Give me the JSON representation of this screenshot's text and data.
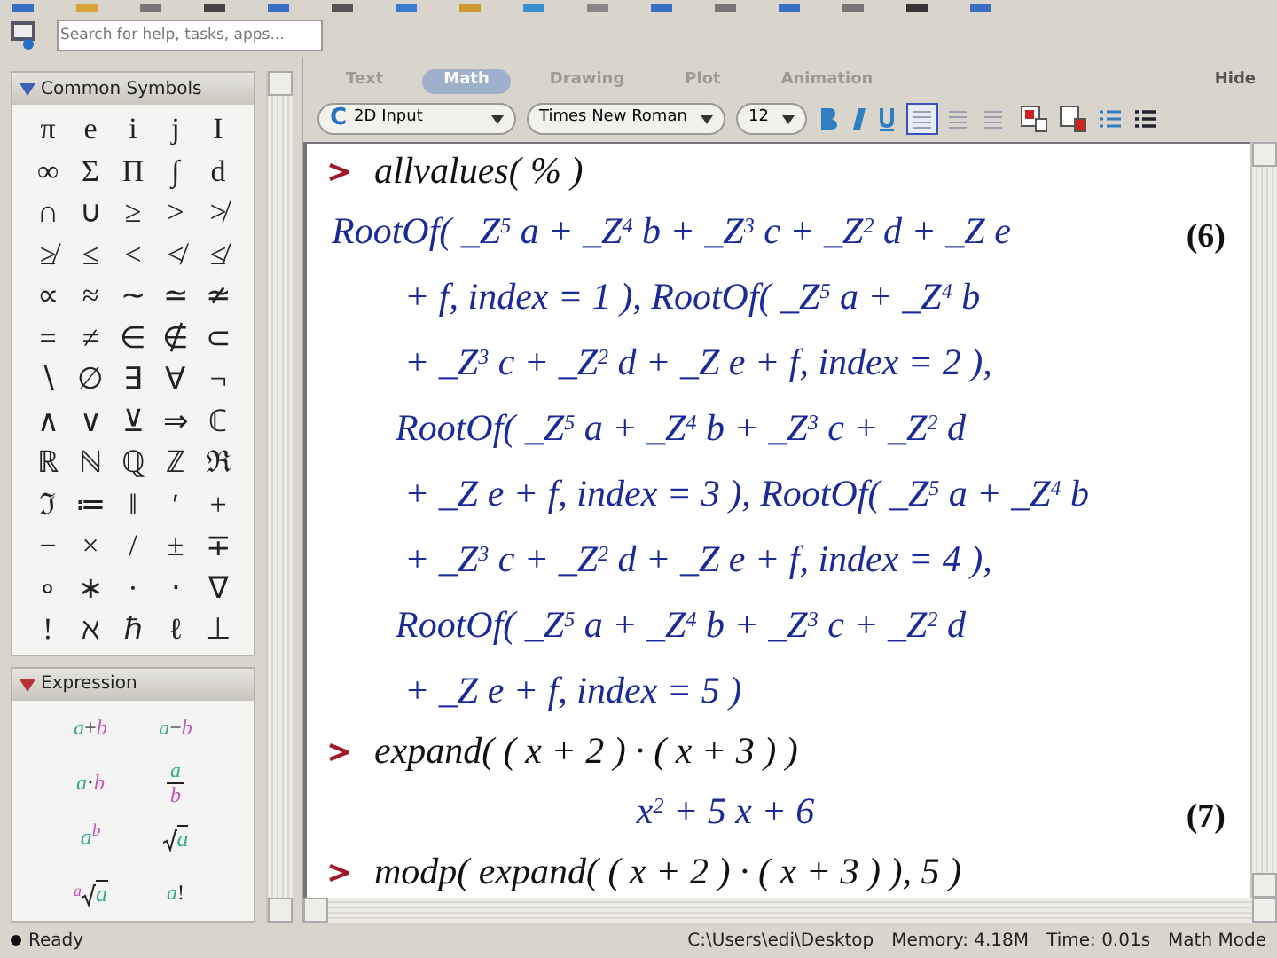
{
  "search": {
    "placeholder": "Search for help, tasks, apps..."
  },
  "palettes": [
    {
      "kind": "symbols",
      "title": "Common Symbols",
      "expanded": true,
      "symbols": [
        "π",
        "e",
        "i",
        "j",
        "I",
        "∞",
        "Σ",
        "Π",
        "∫",
        "d",
        "∩",
        "∪",
        "≥",
        ">",
        "≯",
        "≱",
        "≤",
        "<",
        "≮",
        "≰",
        "∝",
        "≈",
        "∼",
        "≃",
        "≄",
        "=",
        "≠",
        "∈",
        "∉",
        "⊂",
        "∖",
        "∅",
        "∃",
        "∀",
        "¬",
        "∧",
        "∨",
        "⊻",
        "⇒",
        "ℂ",
        "ℝ",
        "ℕ",
        "ℚ",
        "ℤ",
        "ℜ",
        "ℑ",
        "≔",
        "‖",
        "′",
        "+",
        "−",
        "×",
        "/",
        "±",
        "∓",
        "∘",
        "∗",
        "·",
        "⋅",
        "∇",
        "!",
        "ℵ",
        "ℏ",
        "ℓ",
        "⊥"
      ]
    },
    {
      "kind": "expressions",
      "title": "Expression",
      "expanded": true,
      "items": [
        {
          "kind": "infix",
          "parts": [
            "a",
            "+",
            "b"
          ]
        },
        {
          "kind": "infix",
          "parts": [
            "a",
            "−",
            "b"
          ]
        },
        {
          "kind": "infix",
          "parts": [
            "a",
            "·",
            "b"
          ]
        },
        {
          "kind": "fraction",
          "parts": [
            "a",
            "b"
          ]
        },
        {
          "kind": "power",
          "parts": [
            "a",
            "b"
          ]
        },
        {
          "kind": "sqrt",
          "parts": [
            "a"
          ]
        },
        {
          "kind": "root",
          "parts": [
            "a",
            "a"
          ]
        },
        {
          "kind": "postfix",
          "parts": [
            "a",
            "!"
          ]
        }
      ]
    }
  ],
  "tabs": [
    {
      "label": "Text",
      "selected": false
    },
    {
      "label": "Math",
      "selected": true
    },
    {
      "label": "Drawing",
      "selected": false
    },
    {
      "label": "Plot",
      "selected": false
    },
    {
      "label": "Animation",
      "selected": false
    }
  ],
  "hide_button": "Hide",
  "format_bar": {
    "mode_icon": "C",
    "mode": "2D Input",
    "font": "Times New Roman",
    "size": "12",
    "alignment": [
      {
        "selected": true
      },
      {
        "selected": false
      },
      {
        "selected": false
      }
    ]
  },
  "document": [
    {
      "kind": "input",
      "text": "allvalues( % )"
    },
    {
      "kind": "output",
      "label": "(6)",
      "lines": [
        "RootOf( _Z$^{5}$ a + _Z$^{4}$ b + _Z$^{3}$ c + _Z$^{2}$ d + _Z e",
        "+ f, index = 1 ), RootOf( _Z$^{5}$ a + _Z$^{4}$ b",
        "+ _Z$^{3}$ c + _Z$^{2}$ d + _Z e + f, index = 2 ),",
        "RootOf( _Z$^{5}$ a + _Z$^{4}$ b + _Z$^{3}$ c + _Z$^{2}$ d",
        "+ _Z e + f, index = 3 ), RootOf( _Z$^{5}$ a + _Z$^{4}$ b",
        "+ _Z$^{3}$ c + _Z$^{2}$ d + _Z e + f, index = 4 ),",
        "RootOf( _Z$^{5}$ a + _Z$^{4}$ b + _Z$^{3}$ c + _Z$^{2}$ d",
        "+ _Z e + f, index = 5 )"
      ]
    },
    {
      "kind": "input",
      "text": "expand( ( x + 2 ) · ( x + 3 ) )"
    },
    {
      "kind": "output",
      "label": "(7)",
      "centered": true,
      "lines": [
        "x$^{2}$ + 5 x + 6"
      ]
    },
    {
      "kind": "input",
      "text": "modp( expand( ( x + 2 ) · ( x + 3 ) ), 5 )"
    }
  ],
  "status_bar": {
    "state": "Ready",
    "path": "C:\\Users\\edi\\Desktop",
    "memory": "Memory: 4.18M",
    "time": "Time: 0.01s",
    "mode": "Math Mode"
  }
}
